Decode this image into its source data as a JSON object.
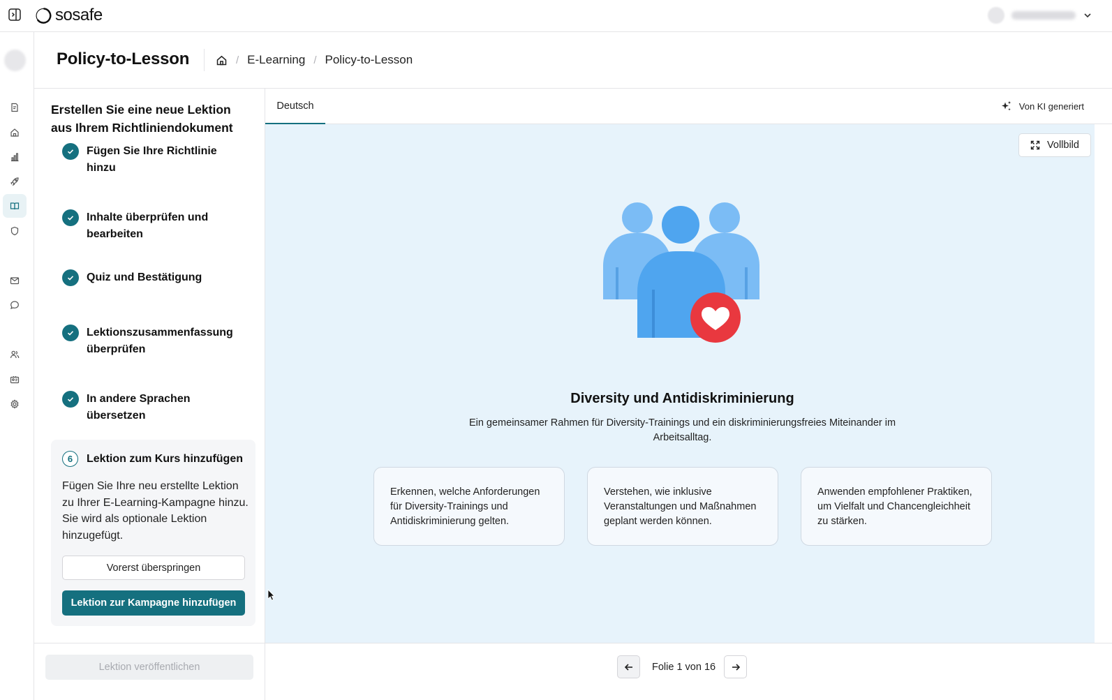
{
  "app": {
    "brand": "sosafe"
  },
  "header": {
    "title": "Policy-to-Lesson",
    "breadcrumb": [
      "E-Learning",
      "Policy-to-Lesson"
    ]
  },
  "steps_panel": {
    "title": "Erstellen Sie eine neue Lektion aus Ihrem Richtliniendokument",
    "completed_steps": [
      "Fügen Sie Ihre Richtlinie hinzu",
      "Inhalte überprüfen und bearbeiten",
      "Quiz und Bestätigung",
      "Lektionszusammenfassung überprüfen",
      "In andere Sprachen übersetzen"
    ],
    "active_step": {
      "number": "6",
      "title": "Lektion zum Kurs hinzufügen",
      "description": "Fügen Sie Ihre neu erstellte Lektion zu Ihrer E-Learning-Kampagne hinzu. Sie wird als optionale Lektion hinzugefügt.",
      "skip_label": "Vorerst überspringen",
      "add_label": "Lektion zur Kampagne hinzufügen"
    },
    "publish_label": "Lektion veröffentlichen"
  },
  "preview": {
    "tab": "Deutsch",
    "ai_badge": "Von KI generiert",
    "fullscreen_label": "Vollbild",
    "slide": {
      "title": "Diversity und Antidiskriminierung",
      "subtitle": "Ein gemeinsamer Rahmen für Diversity-Trainings und ein diskriminierungsfreies Miteinander im Arbeitsalltag.",
      "cards": [
        "Erkennen, welche Anforderungen für Diversity-Trainings und Antidiskriminierung gelten.",
        "Verstehen, wie inklusive Veranstaltungen und Maßnahmen geplant werden können.",
        "Anwenden empfohlener Praktiken, um Vielfalt und Chancengleichheit zu stärken."
      ]
    },
    "pagination": "Folie 1 von 16"
  },
  "colors": {
    "accent": "#15707f",
    "canvas_bg": "#e7f3fb",
    "heart": "#e9383f",
    "person_light": "#7bbcf5",
    "person_main": "#4fa5ef"
  },
  "rail_icons": [
    "document-icon",
    "home-icon",
    "chart-icon",
    "rocket-icon",
    "book-icon",
    "shield-icon",
    "mail-icon",
    "chat-icon",
    "users-icon",
    "id-card-icon",
    "gear-icon"
  ]
}
